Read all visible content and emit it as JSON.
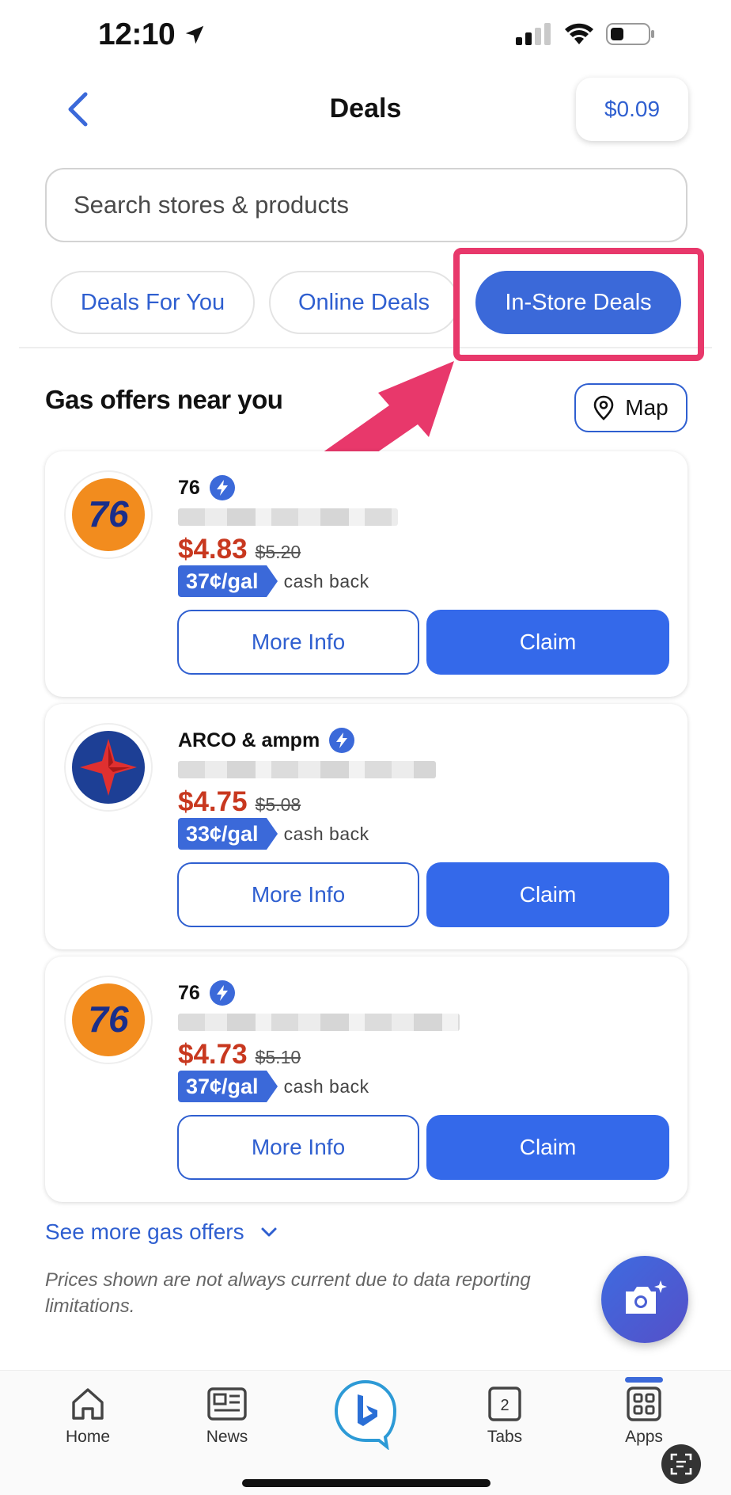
{
  "status_bar": {
    "time": "12:10"
  },
  "header": {
    "title": "Deals",
    "balance": "$0.09"
  },
  "search": {
    "placeholder": "Search stores & products"
  },
  "tabs": [
    {
      "label": "Deals For You",
      "active": false
    },
    {
      "label": "Online Deals",
      "active": false
    },
    {
      "label": "In-Store Deals",
      "active": true
    }
  ],
  "section": {
    "title": "Gas offers near you",
    "map_label": "Map"
  },
  "offers": [
    {
      "brand": "76",
      "price": "$4.83",
      "old_price": "$5.20",
      "cashback": "37¢/gal",
      "cashback_suffix": "cash back",
      "more_info": "More Info",
      "claim": "Claim"
    },
    {
      "brand": "ARCO & ampm",
      "price": "$4.75",
      "old_price": "$5.08",
      "cashback": "33¢/gal",
      "cashback_suffix": "cash back",
      "more_info": "More Info",
      "claim": "Claim"
    },
    {
      "brand": "76",
      "price": "$4.73",
      "old_price": "$5.10",
      "cashback": "37¢/gal",
      "cashback_suffix": "cash back",
      "more_info": "More Info",
      "claim": "Claim"
    }
  ],
  "see_more": "See more gas offers",
  "disclaimer": "Prices shown are not always current due to data reporting limitations.",
  "bottom_nav": [
    {
      "label": "Home",
      "icon": "home-icon"
    },
    {
      "label": "News",
      "icon": "news-icon"
    },
    {
      "label": "",
      "icon": "bing-chat-icon"
    },
    {
      "label": "Tabs",
      "icon": "tabs-icon",
      "count": "2"
    },
    {
      "label": "Apps",
      "icon": "apps-icon"
    }
  ],
  "colors": {
    "accent": "#3b69d9",
    "price_red": "#c8381f",
    "highlight": "#e8386b"
  }
}
